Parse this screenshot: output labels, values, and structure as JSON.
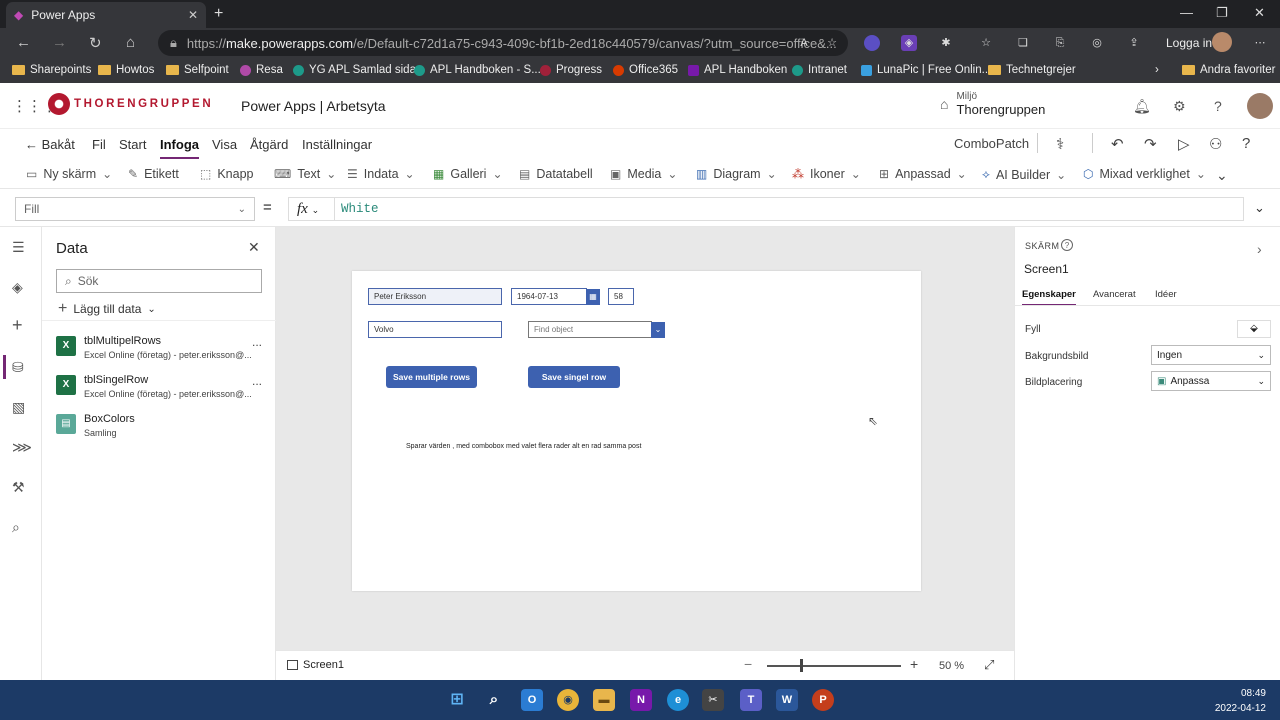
{
  "browser": {
    "tab_title": "Power Apps",
    "url_base": "https://",
    "url_host": "make.powerapps.com",
    "url_path": "/e/Default-c72d1a75-c943-409c-bf1b-2ed18c440579/canvas/?utm_source=office&...",
    "login_label": "Logga in",
    "bookmarks": [
      "Sharepoints",
      "Howtos",
      "Selfpoint",
      "Resa",
      "YG APL Samlad sida",
      "APL Handboken - S...",
      "Progress",
      "Office365",
      "APL Handboken",
      "Intranet",
      "LunaPic | Free Onlin...",
      "Technetgrejer"
    ],
    "other_favorites": "Andra favoriter"
  },
  "header": {
    "brand": "THORENGRUPPEN",
    "app_title": "Power Apps  |  Arbetsyta",
    "env_label": "Miljö",
    "env_name": "Thorengruppen"
  },
  "menubar": {
    "back": "Bakåt",
    "items": [
      "Fil",
      "Start",
      "Infoga",
      "Visa",
      "Åtgärd",
      "Inställningar"
    ],
    "active": "Infoga",
    "app_name": "ComboPatch"
  },
  "ribbon": {
    "items": [
      "Ny skärm",
      "Etikett",
      "Knapp",
      "Text",
      "Indata",
      "Galleri",
      "Datatabell",
      "Media",
      "Diagram",
      "Ikoner",
      "Anpassad",
      "AI Builder",
      "Mixad verklighet"
    ]
  },
  "formula_bar": {
    "property": "Fill",
    "eq": "=",
    "fx": "fx",
    "formula": "White"
  },
  "data_pane": {
    "title": "Data",
    "search_placeholder": "Sök",
    "add_data": "Lägg till data",
    "items": [
      {
        "name": "tblMultipelRows",
        "sub": "Excel Online (företag) - peter.eriksson@...",
        "more": "..."
      },
      {
        "name": "tblSingelRow",
        "sub": "Excel Online (företag) - peter.eriksson@...",
        "more": "..."
      },
      {
        "name": "BoxColors",
        "sub": "Samling"
      }
    ]
  },
  "canvas": {
    "name_input": "Peter Eriksson",
    "date_input": "1964-07-13",
    "age_input": "58",
    "company_input": "Volvo",
    "combobox_placeholder": "Find object",
    "btn_multiple": "Save multiple rows",
    "btn_single": "Save singel row",
    "caption": "Sparar värden , med combobox med valet flera rader alt en rad samma post"
  },
  "status": {
    "screen_name": "Screen1",
    "zoom": "50  %",
    "zoom_level_percent": 50
  },
  "properties": {
    "kind": "SKÄRM",
    "name": "Screen1",
    "tabs": [
      "Egenskaper",
      "Avancerat",
      "Idéer"
    ],
    "active_tab": "Egenskaper",
    "fill_label": "Fyll",
    "bg_image_label": "Bakgrundsbild",
    "bg_image_value": "Ingen",
    "img_position_label": "Bildplacering",
    "img_position_value": "Anpassa"
  },
  "taskbar": {
    "time": "08:49",
    "date": "2022-04-12"
  },
  "colors": {
    "accent": "#742774",
    "canvas_button": "#3d61b0",
    "taskbar": "#1c3a66"
  }
}
